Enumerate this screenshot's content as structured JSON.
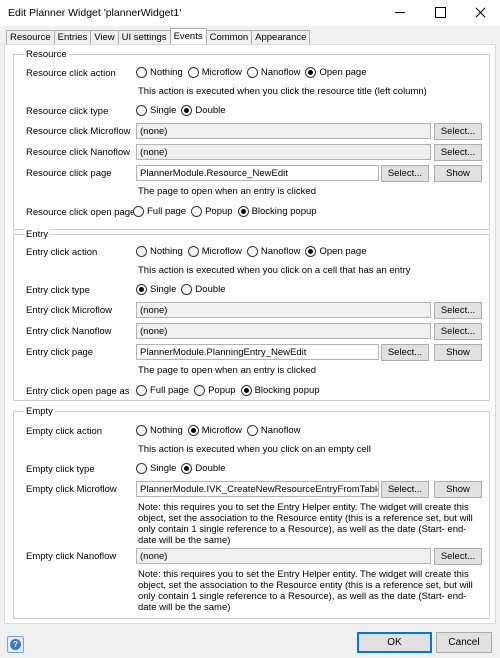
{
  "window": {
    "title": "Edit Planner Widget 'plannerWidget1'"
  },
  "tabs": [
    "Resource",
    "Entries",
    "View",
    "UI settings",
    "Events",
    "Common",
    "Appearance"
  ],
  "active_tab": "Events",
  "common": {
    "select_label": "Select...",
    "show_label": "Show",
    "none_value": "(none)",
    "opt_nothing": "Nothing",
    "opt_microflow": "Microflow",
    "opt_nanoflow": "Nanoflow",
    "opt_open_page": "Open page",
    "opt_single": "Single",
    "opt_double": "Double",
    "opt_full_page": "Full page",
    "opt_popup": "Popup",
    "opt_blocking_popup": "Blocking popup"
  },
  "resource": {
    "title": "Resource",
    "click_action_label": "Resource click action",
    "click_action_value": "Open page",
    "click_action_help": "This action is executed when you click the resource title (left column)",
    "click_type_label": "Resource click type",
    "click_type_value": "Double",
    "microflow_label": "Resource click Microflow",
    "nanoflow_label": "Resource click Nanoflow",
    "page_label": "Resource click page",
    "page_value": "PlannerModule.Resource_NewEdit",
    "page_help": "The page to open when an entry is clicked",
    "open_page_as_label": "Resource click open page as",
    "open_page_as_value": "Blocking popup"
  },
  "entry": {
    "title": "Entry",
    "click_action_label": "Entry click action",
    "click_action_value": "Open page",
    "click_action_help": "This action is executed when you click on a cell that has an entry",
    "click_type_label": "Entry click type",
    "click_type_value": "Single",
    "microflow_label": "Entry click Microflow",
    "nanoflow_label": "Entry click Nanoflow",
    "page_label": "Entry click page",
    "page_value": "PlannerModule.PlanningEntry_NewEdit",
    "page_help": "The page to open when an entry is clicked",
    "open_page_as_label": "Entry click open page as",
    "open_page_as_value": "Blocking popup"
  },
  "empty": {
    "title": "Empty",
    "click_action_label": "Empty click action",
    "click_action_value": "Microflow",
    "click_action_help": "This action is executed when you click on an empty cell",
    "click_type_label": "Empty click type",
    "click_type_value": "Double",
    "microflow_label": "Empty click Microflow",
    "microflow_value": "PlannerModule.IVK_CreateNewResourceEntryFromTable",
    "microflow_note": "Note: this requires you to set the Entry Helper entity. The widget will create this object, set the association to the Resource entity (this is a reference set, but will only contain 1 single reference to a Resource), as well as the date (Start-  end-date will be the same)",
    "nanoflow_label": "Empty click Nanoflow",
    "nanoflow_note": "Note: this requires you to set the Entry Helper entity. The widget will create this object, set the association to the Resource entity (this is a reference set, but will only contain 1 single reference to a Resource), as well as the date (Start-  end-date will be the same)"
  },
  "footer": {
    "ok_label": "OK",
    "cancel_label": "Cancel"
  }
}
